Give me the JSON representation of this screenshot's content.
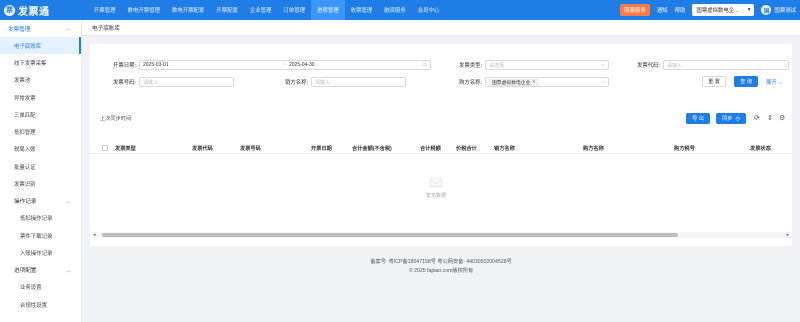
{
  "app": {
    "logo_mark": "票",
    "title": "发票通"
  },
  "nav": [
    "开票管理",
    "数电开票管理",
    "数电开票配置",
    "开票配置",
    "企业管理",
    "订单管理",
    "进项管理",
    "收票管理",
    "融资服务",
    "会员中心"
  ],
  "nav_active_index": 6,
  "topbar": {
    "promo": "限量服务",
    "notice": "通知",
    "help": "帮助",
    "company": "国票虚拟数电企...",
    "user_avatar": "国",
    "user_name": "国票测试"
  },
  "sidebar": {
    "group1": "发票管理",
    "items1": [
      "电子底账库",
      "线下发票采集",
      "发票池",
      "异常发票",
      "三单匹配",
      "抵扣管理",
      "税局入账",
      "批量认证",
      "发票识别"
    ],
    "group2": "操作记录",
    "items2": [
      "抵扣操作记录",
      "票件下载记录",
      "入账操作记录"
    ],
    "group3": "进项配置",
    "items3": [
      "业务设置",
      "合规性设置"
    ]
  },
  "tab": {
    "label": "电子底账库"
  },
  "filters": {
    "start_date_label": "开票日期:",
    "start_date_from": "2025-03-01",
    "date_sep": "~",
    "start_date_to": "2025-04-30",
    "invoice_type_label": "发票类型:",
    "invoice_type_placeholder": "请选择",
    "invoice_code_label": "发票代码:",
    "invoice_code_placeholder": "请输入",
    "invoice_no_label": "发票号码:",
    "invoice_no_placeholder": "请输入",
    "seller_name_label": "销方名称:",
    "seller_name_placeholder": "请输入",
    "buyer_name_label": "购方名称:",
    "buyer_name_tag": "国票虚拟数电企业",
    "reset": "重 置",
    "query": "查 询",
    "expand": "展开"
  },
  "table": {
    "last_sync_label": "上次同步时间:",
    "export_button": "导 出",
    "sync_button": "同步",
    "columns": [
      "发票类型",
      "发票代码",
      "发票号码",
      "开票日期",
      "合计金额(不含税)",
      "合计税额",
      "价税合计",
      "销方名称",
      "购方名称",
      "购方税号",
      "发票状态"
    ],
    "empty_text": "暂无数据"
  },
  "footer": {
    "line1": "备案号: 粤ICP备18047158号    粤公网安备: 44030502004528号",
    "line2": "© 2025 fapiao.com版权所有"
  }
}
